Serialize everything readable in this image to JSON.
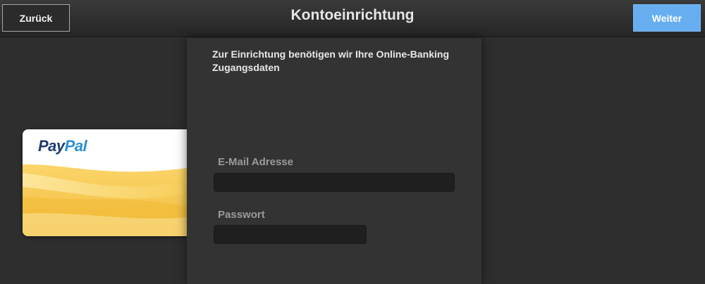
{
  "header": {
    "back_label": "Zurück",
    "title": "Kontoeinrichtung",
    "next_label": "Weiter"
  },
  "panel": {
    "intro_text": "Zur Einrichtung benötigen wir Ihre Online-Banking Zugangsdaten",
    "email_label": "E-Mail Adresse",
    "email_value": "",
    "password_label": "Passwort",
    "password_value": ""
  },
  "card": {
    "brand_pay": "Pay",
    "brand_pal": "Pal"
  },
  "colors": {
    "accent": "#66aef0",
    "brand_dark": "#1d3a73",
    "brand_light": "#2c8fd6",
    "card_yellow": "#f5c64a"
  }
}
